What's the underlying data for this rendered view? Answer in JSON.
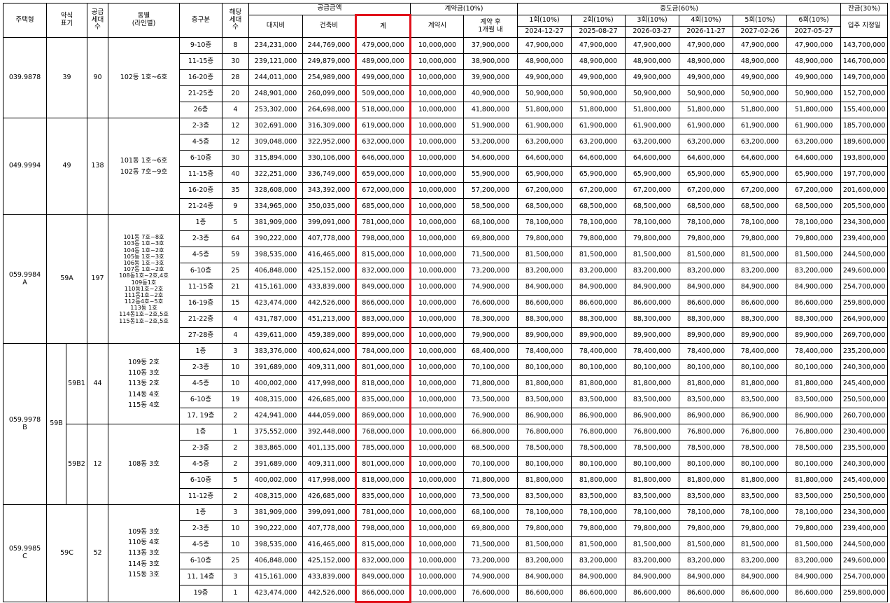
{
  "header": {
    "type_label": "주택형",
    "abbr_label": "약식\n표기",
    "supply_units_label": "공급\n세대\n수",
    "dong_label": "동별\n(라인별)",
    "floor_label": "층구분",
    "units_label": "해당\n세대\n수",
    "supply_price_label": "공급금액",
    "land_label": "대지비",
    "building_label": "건축비",
    "total_label": "계",
    "deposit_label": "계약금(10%)",
    "deposit_on_contract": "계약시",
    "deposit_after": "계약 후\n1개월 내",
    "middle_label": "중도금(60%)",
    "middle_rounds": [
      {
        "label": "1회(10%)",
        "date": "2024-12-27"
      },
      {
        "label": "2회(10%)",
        "date": "2025-08-27"
      },
      {
        "label": "3회(10%)",
        "date": "2026-03-27"
      },
      {
        "label": "4회(10%)",
        "date": "2026-11-27"
      },
      {
        "label": "5회(10%)",
        "date": "2027-02-26"
      },
      {
        "label": "6회(10%)",
        "date": "2027-05-27"
      }
    ],
    "balance_label": "잔금(30%)",
    "balance_when": "입주 지정일"
  },
  "groups": {
    "g1": {
      "type": "039.9878",
      "abbr": "39",
      "units": "90",
      "dong": "102동 1호~6호"
    },
    "g2": {
      "type": "049.9994",
      "abbr": "49",
      "units": "138",
      "dong": "101동 1호~6호\n102동 7호~9호"
    },
    "g3": {
      "type": "059.9984\nA",
      "abbr": "59A",
      "units": "197",
      "dong": "101동 7호~8호\n103동 1호~3호\n104동 1호~2호\n105동 1호~3호\n106동 1호~3호\n107동 1호~2호\n108동1호~2호,4호\n109동1호\n110동1호~2호\n111동1호~2호\n112동4호~5호\n113동 1호\n114동1호~2호,5호\n115동1호~2호,5호"
    },
    "g4": {
      "type": "059.9978\nB",
      "abbr": "59B",
      "sub1": "59B1",
      "units1": "44",
      "dong1": "109동 2호\n110동 3호\n113동 2호\n114동 4호\n115동 4호",
      "sub2": "59B2",
      "units2": "12",
      "dong2": "108동 3호"
    },
    "g5": {
      "type": "059.9985\nC",
      "abbr": "59C",
      "units": "52",
      "dong": "109동 3호\n110동 4호\n113동 3호\n114동 3호\n115동 3호"
    }
  },
  "rows": [
    {
      "floor": "9-10층",
      "units": "8",
      "land": "234,231,000",
      "building": "244,769,000",
      "total": "479,000,000",
      "dep1": "10,000,000",
      "dep2": "37,900,000",
      "mid": "47,900,000",
      "bal": "143,700,000"
    },
    {
      "floor": "11-15층",
      "units": "30",
      "land": "239,121,000",
      "building": "249,879,000",
      "total": "489,000,000",
      "dep1": "10,000,000",
      "dep2": "38,900,000",
      "mid": "48,900,000",
      "bal": "146,700,000"
    },
    {
      "floor": "16-20층",
      "units": "28",
      "land": "244,011,000",
      "building": "254,989,000",
      "total": "499,000,000",
      "dep1": "10,000,000",
      "dep2": "39,900,000",
      "mid": "49,900,000",
      "bal": "149,700,000"
    },
    {
      "floor": "21-25층",
      "units": "20",
      "land": "248,901,000",
      "building": "260,099,000",
      "total": "509,000,000",
      "dep1": "10,000,000",
      "dep2": "40,900,000",
      "mid": "50,900,000",
      "bal": "152,700,000"
    },
    {
      "floor": "26층",
      "units": "4",
      "land": "253,302,000",
      "building": "264,698,000",
      "total": "518,000,000",
      "dep1": "10,000,000",
      "dep2": "41,800,000",
      "mid": "51,800,000",
      "bal": "155,400,000"
    },
    {
      "floor": "2-3층",
      "units": "12",
      "land": "302,691,000",
      "building": "316,309,000",
      "total": "619,000,000",
      "dep1": "10,000,000",
      "dep2": "51,900,000",
      "mid": "61,900,000",
      "bal": "185,700,000"
    },
    {
      "floor": "4-5층",
      "units": "12",
      "land": "309,048,000",
      "building": "322,952,000",
      "total": "632,000,000",
      "dep1": "10,000,000",
      "dep2": "53,200,000",
      "mid": "63,200,000",
      "bal": "189,600,000"
    },
    {
      "floor": "6-10층",
      "units": "30",
      "land": "315,894,000",
      "building": "330,106,000",
      "total": "646,000,000",
      "dep1": "10,000,000",
      "dep2": "54,600,000",
      "mid": "64,600,000",
      "bal": "193,800,000"
    },
    {
      "floor": "11-15층",
      "units": "40",
      "land": "322,251,000",
      "building": "336,749,000",
      "total": "659,000,000",
      "dep1": "10,000,000",
      "dep2": "55,900,000",
      "mid": "65,900,000",
      "bal": "197,700,000"
    },
    {
      "floor": "16-20층",
      "units": "35",
      "land": "328,608,000",
      "building": "343,392,000",
      "total": "672,000,000",
      "dep1": "10,000,000",
      "dep2": "57,200,000",
      "mid": "67,200,000",
      "bal": "201,600,000"
    },
    {
      "floor": "21-24층",
      "units": "9",
      "land": "334,965,000",
      "building": "350,035,000",
      "total": "685,000,000",
      "dep1": "10,000,000",
      "dep2": "58,500,000",
      "mid": "68,500,000",
      "bal": "205,500,000"
    },
    {
      "floor": "1층",
      "units": "5",
      "land": "381,909,000",
      "building": "399,091,000",
      "total": "781,000,000",
      "dep1": "10,000,000",
      "dep2": "68,100,000",
      "mid": "78,100,000",
      "bal": "234,300,000"
    },
    {
      "floor": "2-3층",
      "units": "64",
      "land": "390,222,000",
      "building": "407,778,000",
      "total": "798,000,000",
      "dep1": "10,000,000",
      "dep2": "69,800,000",
      "mid": "79,800,000",
      "bal": "239,400,000"
    },
    {
      "floor": "4-5층",
      "units": "59",
      "land": "398,535,000",
      "building": "416,465,000",
      "total": "815,000,000",
      "dep1": "10,000,000",
      "dep2": "71,500,000",
      "mid": "81,500,000",
      "bal": "244,500,000"
    },
    {
      "floor": "6-10층",
      "units": "25",
      "land": "406,848,000",
      "building": "425,152,000",
      "total": "832,000,000",
      "dep1": "10,000,000",
      "dep2": "73,200,000",
      "mid": "83,200,000",
      "bal": "249,600,000"
    },
    {
      "floor": "11-15층",
      "units": "21",
      "land": "415,161,000",
      "building": "433,839,000",
      "total": "849,000,000",
      "dep1": "10,000,000",
      "dep2": "74,900,000",
      "mid": "84,900,000",
      "bal": "254,700,000"
    },
    {
      "floor": "16-19층",
      "units": "15",
      "land": "423,474,000",
      "building": "442,526,000",
      "total": "866,000,000",
      "dep1": "10,000,000",
      "dep2": "76,600,000",
      "mid": "86,600,000",
      "bal": "259,800,000"
    },
    {
      "floor": "21-22층",
      "units": "4",
      "land": "431,787,000",
      "building": "451,213,000",
      "total": "883,000,000",
      "dep1": "10,000,000",
      "dep2": "78,300,000",
      "mid": "88,300,000",
      "bal": "264,900,000"
    },
    {
      "floor": "27-28층",
      "units": "4",
      "land": "439,611,000",
      "building": "459,389,000",
      "total": "899,000,000",
      "dep1": "10,000,000",
      "dep2": "79,900,000",
      "mid": "89,900,000",
      "bal": "269,700,000"
    },
    {
      "floor": "1층",
      "units": "3",
      "land": "383,376,000",
      "building": "400,624,000",
      "total": "784,000,000",
      "dep1": "10,000,000",
      "dep2": "68,400,000",
      "mid": "78,400,000",
      "bal": "235,200,000"
    },
    {
      "floor": "2-3층",
      "units": "10",
      "land": "391,689,000",
      "building": "409,311,000",
      "total": "801,000,000",
      "dep1": "10,000,000",
      "dep2": "70,100,000",
      "mid": "80,100,000",
      "bal": "240,300,000"
    },
    {
      "floor": "4-5층",
      "units": "10",
      "land": "400,002,000",
      "building": "417,998,000",
      "total": "818,000,000",
      "dep1": "10,000,000",
      "dep2": "71,800,000",
      "mid": "81,800,000",
      "bal": "245,400,000"
    },
    {
      "floor": "6-10층",
      "units": "19",
      "land": "408,315,000",
      "building": "426,685,000",
      "total": "835,000,000",
      "dep1": "10,000,000",
      "dep2": "73,500,000",
      "mid": "83,500,000",
      "bal": "250,500,000"
    },
    {
      "floor": "17, 19층",
      "units": "2",
      "land": "424,941,000",
      "building": "444,059,000",
      "total": "869,000,000",
      "dep1": "10,000,000",
      "dep2": "76,900,000",
      "mid": "86,900,000",
      "bal": "260,700,000"
    },
    {
      "floor": "1층",
      "units": "1",
      "land": "375,552,000",
      "building": "392,448,000",
      "total": "768,000,000",
      "dep1": "10,000,000",
      "dep2": "66,800,000",
      "mid": "76,800,000",
      "bal": "230,400,000"
    },
    {
      "floor": "2-3층",
      "units": "2",
      "land": "383,865,000",
      "building": "401,135,000",
      "total": "785,000,000",
      "dep1": "10,000,000",
      "dep2": "68,500,000",
      "mid": "78,500,000",
      "bal": "235,500,000"
    },
    {
      "floor": "4-5층",
      "units": "2",
      "land": "391,689,000",
      "building": "409,311,000",
      "total": "801,000,000",
      "dep1": "10,000,000",
      "dep2": "70,100,000",
      "mid": "80,100,000",
      "bal": "240,300,000"
    },
    {
      "floor": "6-10층",
      "units": "5",
      "land": "400,002,000",
      "building": "417,998,000",
      "total": "818,000,000",
      "dep1": "10,000,000",
      "dep2": "71,800,000",
      "mid": "81,800,000",
      "bal": "245,400,000"
    },
    {
      "floor": "11-12층",
      "units": "2",
      "land": "408,315,000",
      "building": "426,685,000",
      "total": "835,000,000",
      "dep1": "10,000,000",
      "dep2": "73,500,000",
      "mid": "83,500,000",
      "bal": "250,500,000"
    },
    {
      "floor": "1층",
      "units": "3",
      "land": "381,909,000",
      "building": "399,091,000",
      "total": "781,000,000",
      "dep1": "10,000,000",
      "dep2": "68,100,000",
      "mid": "78,100,000",
      "bal": "234,300,000"
    },
    {
      "floor": "2-3층",
      "units": "10",
      "land": "390,222,000",
      "building": "407,778,000",
      "total": "798,000,000",
      "dep1": "10,000,000",
      "dep2": "69,800,000",
      "mid": "79,800,000",
      "bal": "239,400,000"
    },
    {
      "floor": "4-5층",
      "units": "10",
      "land": "398,535,000",
      "building": "416,465,000",
      "total": "815,000,000",
      "dep1": "10,000,000",
      "dep2": "71,500,000",
      "mid": "81,500,000",
      "bal": "244,500,000"
    },
    {
      "floor": "6-10층",
      "units": "25",
      "land": "406,848,000",
      "building": "425,152,000",
      "total": "832,000,000",
      "dep1": "10,000,000",
      "dep2": "73,200,000",
      "mid": "83,200,000",
      "bal": "249,600,000"
    },
    {
      "floor": "11, 14층",
      "units": "3",
      "land": "415,161,000",
      "building": "433,839,000",
      "total": "849,000,000",
      "dep1": "10,000,000",
      "dep2": "74,900,000",
      "mid": "84,900,000",
      "bal": "254,700,000"
    },
    {
      "floor": "19층",
      "units": "1",
      "land": "423,474,000",
      "building": "442,526,000",
      "total": "866,000,000",
      "dep1": "10,000,000",
      "dep2": "76,600,000",
      "mid": "86,600,000",
      "bal": "259,800,000"
    }
  ],
  "highlight_color": "#e0101a"
}
